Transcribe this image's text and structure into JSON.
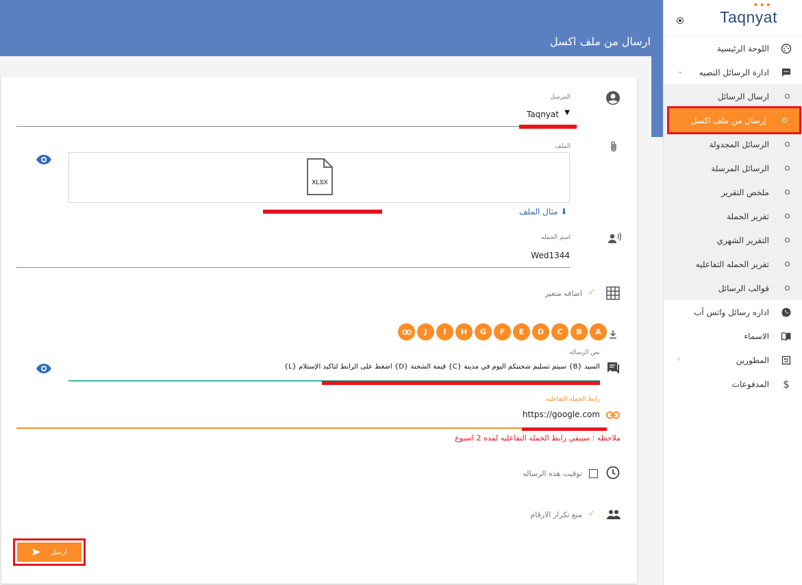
{
  "header": {
    "title": "ارسال من ملف اكسل"
  },
  "brand": {
    "logo": "Taqnyat",
    "accent": "#fb8c27",
    "header_color": "#5b80c2"
  },
  "sidebar": {
    "items": [
      {
        "label": "اللوحة الرئيسية",
        "icon": "dashboard-icon"
      },
      {
        "label": "ادارة الرسائل النصيه",
        "icon": "sms-icon"
      },
      {
        "label": "اداره رسائل واتس آب",
        "icon": "whatsapp-icon"
      },
      {
        "label": "الاسماء",
        "icon": "contacts-book-icon"
      },
      {
        "label": "المطورين",
        "icon": "developer-icon"
      },
      {
        "label": "المدفوعات",
        "icon": "dollar-icon"
      }
    ],
    "sub_items": [
      {
        "label": "ارسال الرسائل"
      },
      {
        "label": "إرسال من ملف اكسل"
      },
      {
        "label": "الرسائل المجدولة"
      },
      {
        "label": "الرسائل المرسلة"
      },
      {
        "label": "ملخص التقرير"
      },
      {
        "label": "تقرير الحملة"
      },
      {
        "label": "التقرير الشهري"
      },
      {
        "label": "تقرير الحمله التفاعليه"
      },
      {
        "label": "قوالب الرسائل"
      }
    ]
  },
  "form": {
    "sender_label": "المرسل",
    "sender_value": "Taqnyat",
    "file_label": "الملف",
    "file_type": "XLSX",
    "file_example": "مثال الملف",
    "campaign_label": "اسم الحمله",
    "campaign_value": "Wed1344",
    "add_variable": "اضافه متغير",
    "tags": [
      "A",
      "B",
      "C",
      "D",
      "E",
      "F",
      "G",
      "H",
      "I",
      "J"
    ],
    "message_label": "نص الرساله",
    "message_value": "السيد {B} سيتم تسليم شحنتكم اليوم في مدينة {C} قيمة الشحنة {D} اضغط على الرابط لتاكيد الإستلام {L}",
    "link_label": "رابط الحمله التفاعليه",
    "link_value": "https://google.com",
    "note": "ملاحظه : سيبقي رابط الحمله التفاعليه لمده 2 اسبوع",
    "schedule_label": "توقيت هذه الرساله",
    "dedupe_label": "منع تكرار الارقام",
    "send_label": "ارسل"
  }
}
